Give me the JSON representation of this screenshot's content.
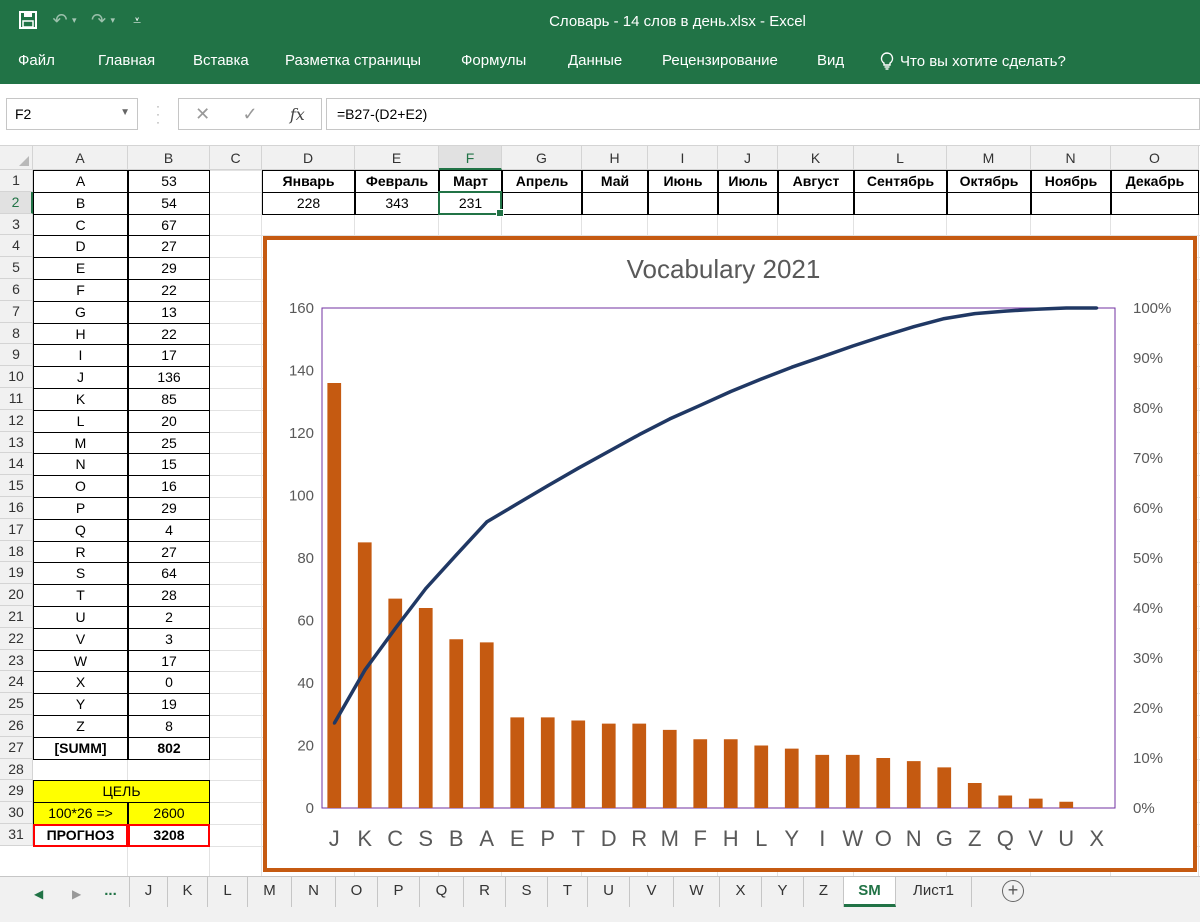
{
  "titlebar": {
    "title": "Словарь - 14 слов в день.xlsx - Excel"
  },
  "ribbon": {
    "tabs": [
      "Файл",
      "Главная",
      "Вставка",
      "Разметка страницы",
      "Формулы",
      "Данные",
      "Рецензирование",
      "Вид"
    ],
    "tell_me": "Что вы хотите сделать?"
  },
  "formula_bar": {
    "name_box": "F2",
    "formula": "=B27-(D2+E2)"
  },
  "grid": {
    "columns": [
      "A",
      "B",
      "C",
      "D",
      "E",
      "F",
      "G",
      "H",
      "I",
      "J",
      "K",
      "L",
      "M",
      "N",
      "O"
    ],
    "selected_column": "F",
    "rows": [
      "1",
      "2",
      "3",
      "4",
      "5",
      "6",
      "7",
      "8",
      "9",
      "10",
      "11",
      "12",
      "13",
      "14",
      "15",
      "16",
      "17",
      "18",
      "19",
      "20",
      "21",
      "22",
      "23",
      "24",
      "25",
      "26",
      "27",
      "28",
      "29",
      "30",
      "31"
    ],
    "selected_row": "2",
    "letters": [
      [
        "A",
        "53"
      ],
      [
        "B",
        "54"
      ],
      [
        "C",
        "67"
      ],
      [
        "D",
        "27"
      ],
      [
        "E",
        "29"
      ],
      [
        "F",
        "22"
      ],
      [
        "G",
        "13"
      ],
      [
        "H",
        "22"
      ],
      [
        "I",
        "17"
      ],
      [
        "J",
        "136"
      ],
      [
        "K",
        "85"
      ],
      [
        "L",
        "20"
      ],
      [
        "M",
        "25"
      ],
      [
        "N",
        "15"
      ],
      [
        "O",
        "16"
      ],
      [
        "P",
        "29"
      ],
      [
        "Q",
        "4"
      ],
      [
        "R",
        "27"
      ],
      [
        "S",
        "64"
      ],
      [
        "T",
        "28"
      ],
      [
        "U",
        "2"
      ],
      [
        "V",
        "3"
      ],
      [
        "W",
        "17"
      ],
      [
        "X",
        "0"
      ],
      [
        "Y",
        "19"
      ],
      [
        "Z",
        "8"
      ]
    ],
    "summ_label": "[SUMM]",
    "summ_value": "802",
    "goal_label": "ЦЕЛЬ",
    "goal_formula": "100*26 =>",
    "goal_value": "2600",
    "forecast_label": "ПРОГНОЗ",
    "forecast_value": "3208",
    "months": [
      "Январь",
      "Февраль",
      "Март",
      "Апрель",
      "Май",
      "Июнь",
      "Июль",
      "Август",
      "Сентябрь",
      "Октябрь",
      "Ноябрь",
      "Декабрь"
    ],
    "month_values": [
      "228",
      "343",
      "231",
      "",
      "",
      "",
      "",
      "",
      "",
      "",
      "",
      ""
    ]
  },
  "chart_data": {
    "type": "bar",
    "title": "Vocabulary 2021",
    "categories": [
      "J",
      "K",
      "C",
      "S",
      "B",
      "A",
      "E",
      "P",
      "T",
      "D",
      "R",
      "M",
      "F",
      "H",
      "L",
      "Y",
      "I",
      "W",
      "O",
      "N",
      "G",
      "Z",
      "Q",
      "V",
      "U",
      "X"
    ],
    "series": [
      {
        "values": [
          136,
          85,
          67,
          64,
          54,
          53,
          29,
          29,
          28,
          27,
          27,
          25,
          22,
          22,
          20,
          19,
          17,
          17,
          16,
          15,
          13,
          8,
          4,
          3,
          2,
          0
        ]
      },
      {
        "type": "line",
        "axis": "secondary",
        "values": [
          16.96,
          27.56,
          35.91,
          43.89,
          50.62,
          57.23,
          60.85,
          64.46,
          67.96,
          71.32,
          74.69,
          77.81,
          80.55,
          83.29,
          85.79,
          88.15,
          90.27,
          92.39,
          94.39,
          96.26,
          97.88,
          98.88,
          99.38,
          99.75,
          100.0,
          100.0
        ]
      }
    ],
    "ylim": [
      0,
      160
    ],
    "yticks": [
      "0",
      "20",
      "40",
      "60",
      "80",
      "100",
      "120",
      "140",
      "160"
    ],
    "y2lim": [
      0,
      100
    ],
    "y2ticks": [
      "0%",
      "10%",
      "20%",
      "30%",
      "40%",
      "50%",
      "60%",
      "70%",
      "80%",
      "90%",
      "100%"
    ],
    "colors": {
      "bars": "#c55a11",
      "line": "#203864",
      "plot_border": "#7030a0"
    },
    "legend": "none",
    "grid": false
  },
  "sheet_tabs": {
    "ellipsis": "...",
    "tabs": [
      "J",
      "K",
      "L",
      "M",
      "N",
      "O",
      "P",
      "Q",
      "R",
      "S",
      "T",
      "U",
      "V",
      "W",
      "X",
      "Y",
      "Z",
      "SM",
      "Лист1"
    ],
    "active": "SM",
    "add": "+"
  }
}
